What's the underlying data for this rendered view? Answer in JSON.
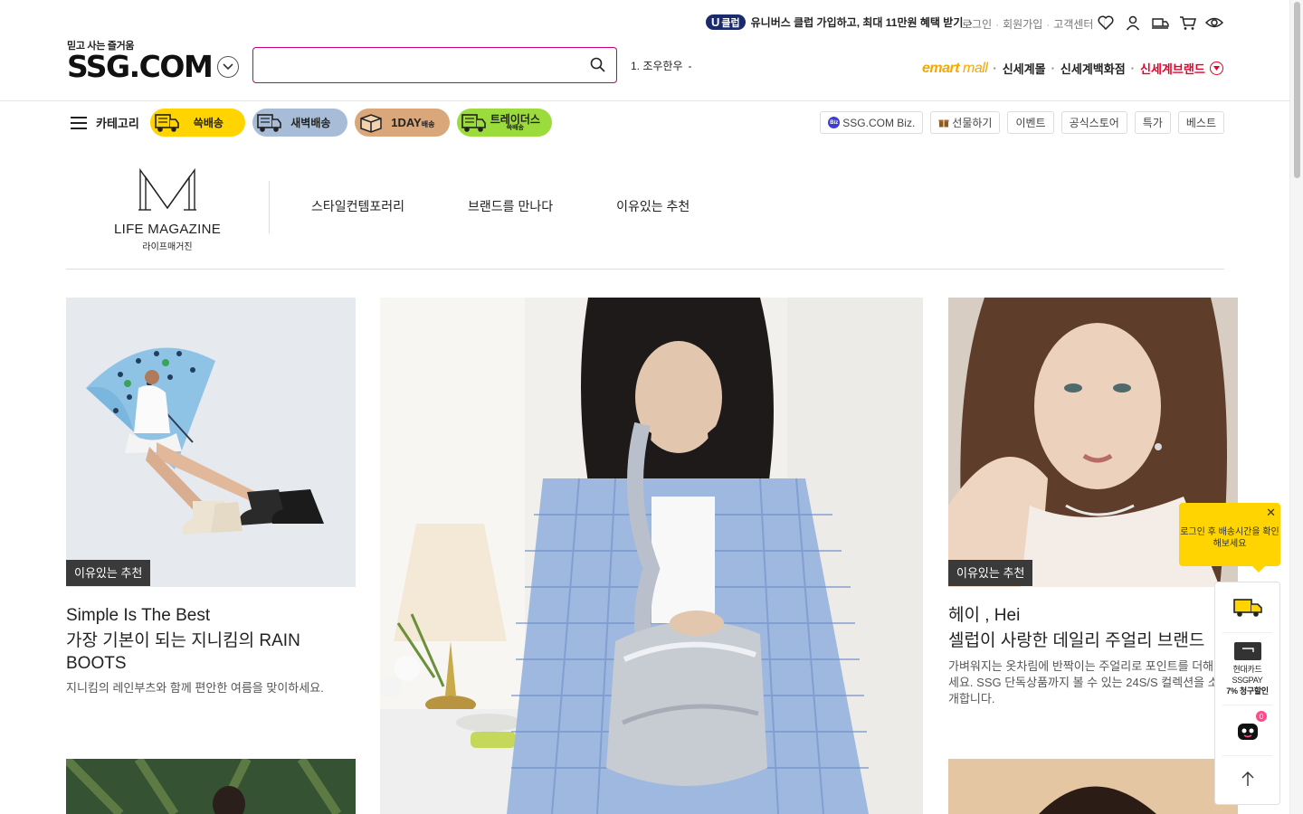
{
  "header": {
    "promo": {
      "badge_u": "U",
      "badge_text": "클럽",
      "text": "유니버스 클럽 가입하고, 최대 11만원 혜택 받기",
      "arrow": "›"
    },
    "member_links": [
      "로그인",
      "회원가입",
      "고객센터"
    ],
    "member_sep": "·",
    "util_icons": [
      "heart-icon",
      "user-icon",
      "delivery-icon",
      "cart-icon",
      "eye-icon"
    ],
    "logo_tagline": "믿고 사는 즐거움",
    "logo": "SSG.COM",
    "search": {
      "value": "",
      "placeholder": ""
    },
    "rank": {
      "text": "1. 조우한우",
      "trail": "-"
    },
    "malls": {
      "emart": "emart",
      "emart_suffix": "mall",
      "items": [
        "신세계몰",
        "신세계백화점",
        "신세계브랜드"
      ],
      "sep": "·"
    }
  },
  "catbar": {
    "category_label": "카테고리",
    "pills": [
      {
        "label": "쓱배송",
        "color": "#ffd400"
      },
      {
        "label": "새벽배송",
        "color": "#a7bcd6"
      },
      {
        "label_big": "1DAY",
        "label_small": "배송",
        "color": "#d9a77a"
      },
      {
        "label_big": "트레이더스",
        "label_small": "쓱배송",
        "color": "#9bdc3c"
      }
    ],
    "quick_links": [
      "SSG.COM Biz.",
      "선물하기",
      "이벤트",
      "공식스토어",
      "특가",
      "베스트"
    ],
    "biz_badge": "Biz"
  },
  "magazine": {
    "logo_title": "LIFE MAGAZINE",
    "logo_sub": "라이프매거진",
    "nav": [
      "스타일컨템포러리",
      "브랜드를 만나다",
      "이유있는 추천"
    ]
  },
  "cards": [
    {
      "tag": "이유있는 추천",
      "title_en": "Simple Is The Best",
      "title_ko": "가장 기본이 되는 지니킴의 RAIN BOOTS",
      "desc": "지니킴의 레인부츠와 함께 편안한 여름을 맞이하세요."
    },
    {
      "tag": "이유있는 추천",
      "title_en": "헤이 , Hei",
      "title_ko": "셀럽이 사랑한 데일리 주얼리 브랜드",
      "desc": "가벼워지는 옷차림에 반짝이는 주얼리로 포인트를 더해보세요. SSG 단독상품까지 볼 수 있는 24S/S 컬렉션을 소개합니다."
    }
  ],
  "side_widget": {
    "tooltip": "로그인 후 배송시간을 확인해보세요",
    "close": "✕",
    "card_line1": "현대카드",
    "card_line2": "SSGPAY",
    "card_line3": "7% 청구할인",
    "chat_badge": "0"
  },
  "colors": {
    "accent": "#c5007a",
    "ssg_yellow": "#ffd400",
    "red": "#e4002b"
  }
}
